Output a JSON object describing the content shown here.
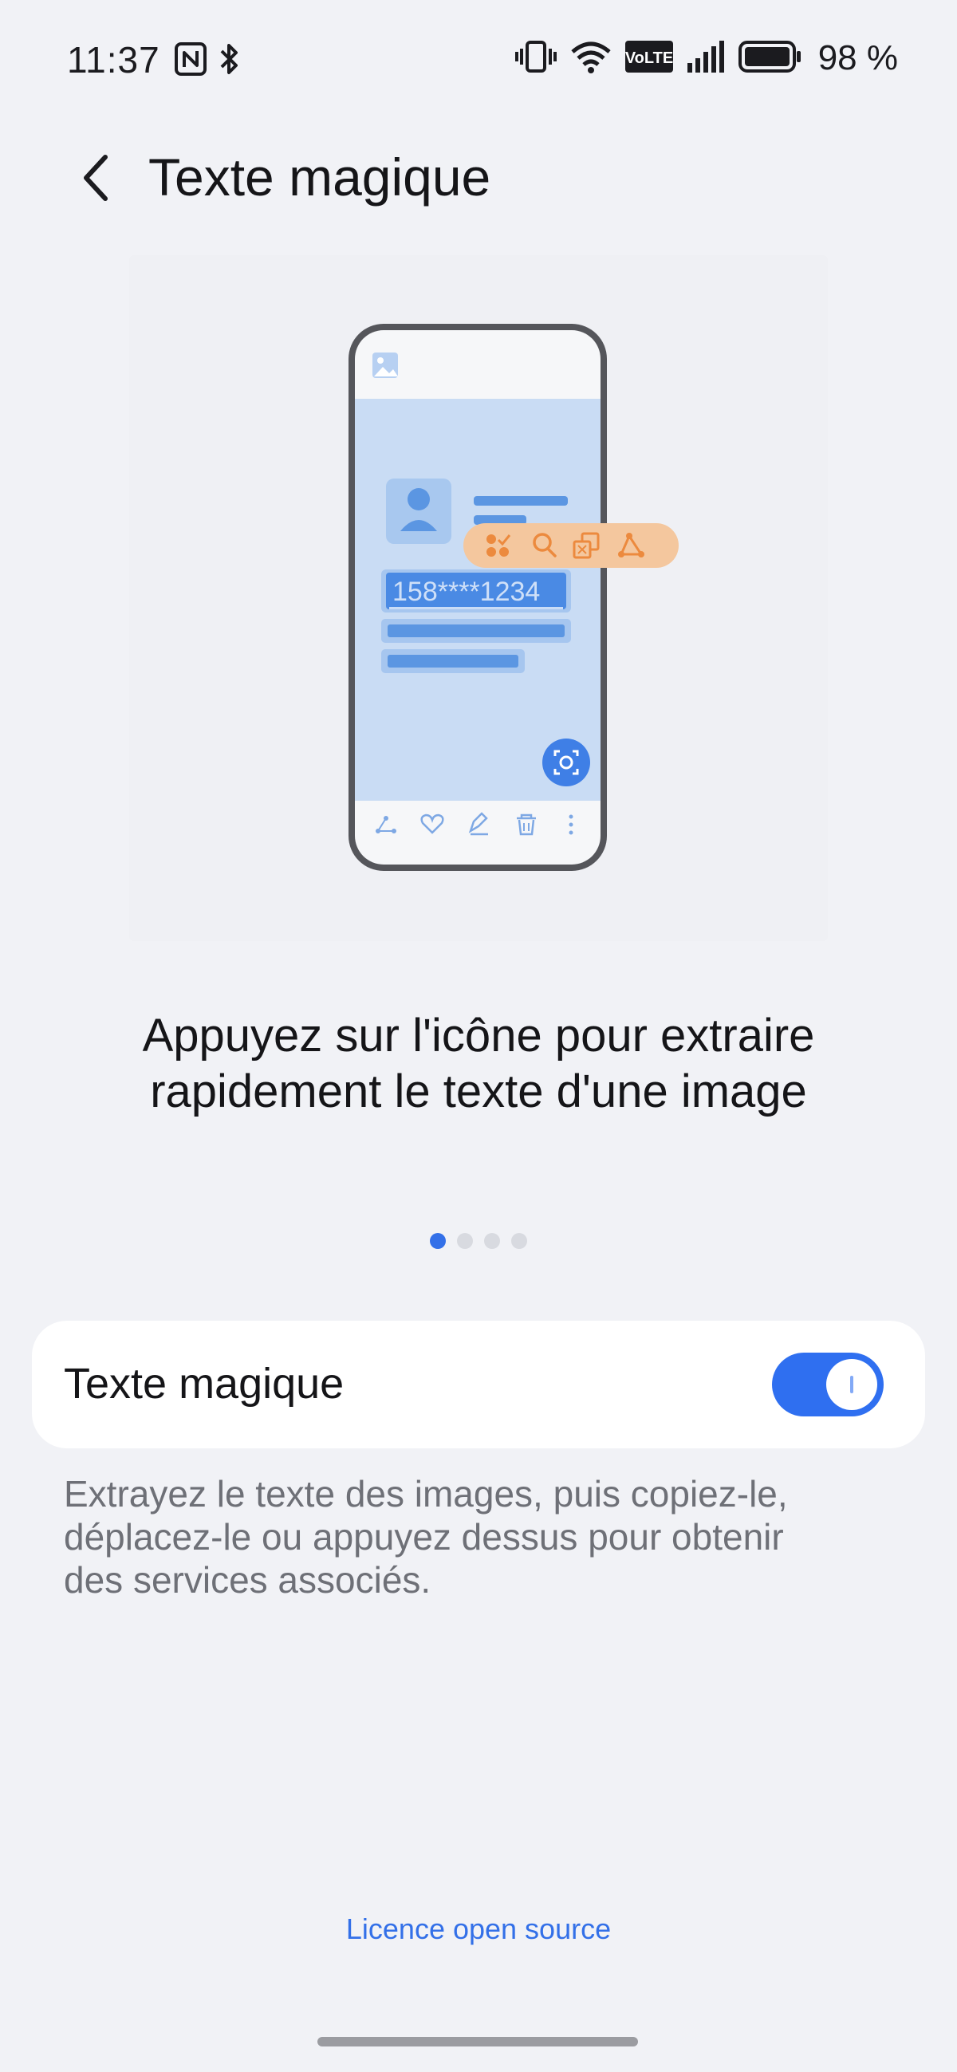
{
  "status_bar": {
    "time": "11:37",
    "battery": "98 %",
    "volte_label": "VoLTE",
    "icons": [
      "nfc-icon",
      "bluetooth-icon",
      "vibrate-icon",
      "wifi-icon",
      "volte-icon",
      "signal-icon",
      "battery-icon"
    ]
  },
  "header": {
    "title": "Texte magique",
    "back_icon": "back-arrow-icon"
  },
  "illustration": {
    "phone_number": "158****1234",
    "popup_icons": [
      "apps-check-icon",
      "search-icon",
      "translate-icon",
      "share-icon"
    ],
    "bottom_icons": [
      "share-icon",
      "heart-icon",
      "edit-icon",
      "delete-icon",
      "more-icon"
    ],
    "colors": {
      "accent": "#f0a86b",
      "screen": "#c8dbf3",
      "highlight": "#4a8ae4"
    }
  },
  "caption": {
    "line1": "Appuyez sur l'icône pour extraire",
    "line2": "rapidement le texte d'une image"
  },
  "pager": {
    "total": 4,
    "active": 1
  },
  "setting": {
    "label": "Texte magique",
    "enabled": true
  },
  "description": {
    "line1": "Extrayez le texte des images, puis copiez-le,",
    "line2": "déplacez-le ou appuyez dessus pour obtenir",
    "line3": "des services associés."
  },
  "footer": {
    "link_label": "Licence open source"
  },
  "colors": {
    "accent": "#3370e8",
    "background": "#f1f2f6",
    "card": "#ffffff"
  }
}
